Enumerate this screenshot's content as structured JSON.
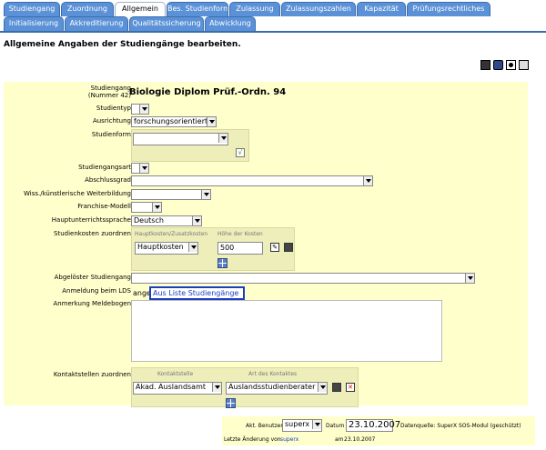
{
  "tabs_top": [
    "Studiengang",
    "Zuordnung",
    "Allgemein",
    "Bes. Studienform",
    "Zulassung",
    "Zulassungszahlen",
    "Kapazität",
    "Prüfungsrechtliches"
  ],
  "tabs_bottom": [
    "Initialisierung",
    "Akkreditierung",
    "Qualitätssicherung",
    "Abwicklung"
  ],
  "active_tab": "Allgemein",
  "header_title": "Allgemeine Angaben der Studiengänge bearbeiten.",
  "studiengang": {
    "label": "Studiengang",
    "sublabel": "(Nummer 42)",
    "value": "Biologie Diplom Prüf.-Ordn. 94"
  },
  "labels": {
    "studientyp": "Studientyp",
    "ausrichtung": "Ausrichtung",
    "studienform": "Studienform",
    "studiengangsart": "Studiengangsart",
    "abschlussgrad": "Abschlussgrad",
    "weiterbildung": "Wiss./künstlerische Weiterbildung",
    "franchise": "Franchise-Modell",
    "hauptunterrichtssprache": "Hauptunterrichtssprache",
    "studienkosten": "Studienkosten zuordnen",
    "abgeloester": "Abgelöster Studiengang",
    "anmeldung": "Anmeldung beim LDS",
    "anmerkung": "Anmerkung Meldebogen",
    "kontaktstellen": "Kontaktstellen zuordnen"
  },
  "values": {
    "ausrichtung": "forschungsorientiert",
    "hauptunterrichtssprache": "Deutsch",
    "kostenart": "Hauptkosten",
    "kostenhoehe": "500",
    "anmeldung_prefix": "ange",
    "anmeldung_popup": "Aus Liste Studiengänge",
    "kontaktstelle": "Akad. Auslandsamt",
    "kontaktart": "Auslandsstudienberater"
  },
  "studienkosten_headers": {
    "art": "Hauptkosten/Zusatzkosten",
    "hoehe": "Höhe der Kosten"
  },
  "kontakt_headers": {
    "stelle": "Kontaktstelle",
    "art": "Art des Kontaktes"
  },
  "footer": {
    "benutzer_label": "Akt. Benutzer",
    "benutzer": "superx",
    "datum_label": "Datum",
    "datum": "23.10.2007",
    "quelle": "Datenquelle: SuperX SOS-Modul (geschützt)",
    "letzte_label": "Letzte Änderung von",
    "letzte_user": "superx",
    "am_label": "am",
    "am_datum": "23.10.2007"
  },
  "colors": {
    "tab": "#5b91d6",
    "form_bg": "#ffffcc",
    "subbox": "#eeeebb"
  }
}
